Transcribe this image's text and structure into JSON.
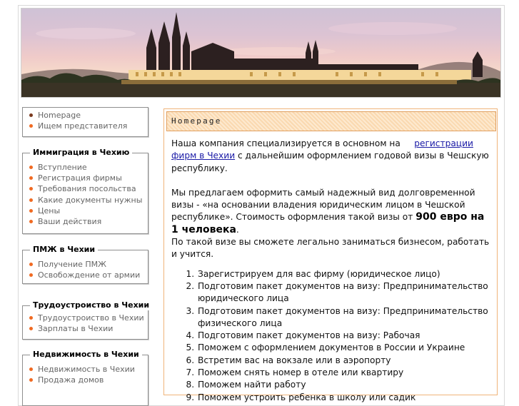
{
  "sidebar": {
    "top_links": [
      {
        "label": "Homepage",
        "active": true
      },
      {
        "label": "Ищем представителя",
        "active": false
      }
    ],
    "sections": [
      {
        "title": "Иммиграция в Чехию",
        "items": [
          "Вступление",
          "Регистрация фирмы",
          "Требования посольства",
          "Какие документы нужны",
          "Цены",
          "Ваши действия"
        ]
      },
      {
        "title": "ПМЖ в Чехии",
        "items": [
          "Получение ПМЖ",
          "Освобождение от армии"
        ]
      },
      {
        "title": "Трудоустроиство в Чехии",
        "items": [
          "Трудоустроиство в Чехии",
          "Зарплаты в Чехии"
        ]
      },
      {
        "title": "Недвижимость в Чехии",
        "items": [
          "Недвижимость в Чехии",
          "Продажа домов"
        ]
      }
    ]
  },
  "main": {
    "heading": "Homepage",
    "intro_before_link": "Наша компания специализируется в основном на",
    "intro_link": "регистрации фирм в Чехии",
    "intro_after_link": "с дальнейшим оформлением годовой визы в Чешскую республику.",
    "offer_text": "Мы предлагаем оформить самый надежный вид долговременной визы - «на основании владения юридическим лицом в Чешской республике». Стоимость оформления такой визы от",
    "price": "900 евро на 1 человека",
    "price_suffix": ".",
    "business_text": "По такой визе вы сможете легально заниматься бизнесом, работать и учится.",
    "steps": [
      "Зарегистрируем для вас фирму (юридическое лицо)",
      "Подготовим пакет документов на визу: Предпринимательство юридического лица",
      "Подготовим пакет документов на визу: Предпринимательство физического лица",
      "Подготовим пакет документов на визу: Рабочая",
      "Поможем с оформлением документов в России и Украине",
      "Встретим вас на вокзале или в аэропорту",
      "Поможем снять номер в отеле или квартиру",
      "Поможем найти работу",
      "Поможем устроить ребенка в школу или садик"
    ]
  },
  "colors": {
    "accent_orange": "#f06a22",
    "heading_border": "#e0a060",
    "link_blue": "#1a1aa6"
  }
}
